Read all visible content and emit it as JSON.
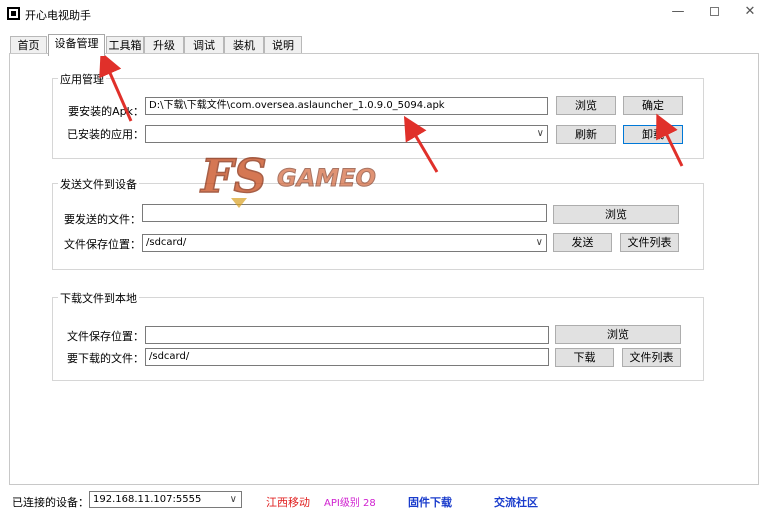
{
  "window": {
    "title": "开心电视助手",
    "minimize_label": "—",
    "close_label": "✕"
  },
  "tabs": [
    {
      "label": "首页"
    },
    {
      "label": "设备管理"
    },
    {
      "label": "工具箱"
    },
    {
      "label": "升级"
    },
    {
      "label": "调试"
    },
    {
      "label": "装机"
    },
    {
      "label": "说明"
    }
  ],
  "app_manage": {
    "title": "应用管理",
    "apk_label": "要安装的Apk：",
    "apk_value": "D:\\下载\\下载文件\\com.oversea.aslauncher_1.0.9.0_5094.apk",
    "browse_label": "浏览",
    "confirm_label": "确定",
    "installed_label": "已安装的应用：",
    "installed_value": "",
    "refresh_label": "刷新",
    "uninstall_label": "卸载"
  },
  "send_file": {
    "title": "发送文件到设备",
    "file_label": "要发送的文件：",
    "file_value": "",
    "browse_label": "浏览",
    "save_label": "文件保存位置：",
    "save_value": "/sdcard/",
    "send_label": "发送",
    "filelist_label": "文件列表"
  },
  "download_file": {
    "title": "下载文件到本地",
    "save_label": "文件保存位置：",
    "save_value": "",
    "browse_label": "浏览",
    "file_label": "要下载的文件：",
    "file_value": "/sdcard/",
    "download_label": "下载",
    "filelist_label": "文件列表"
  },
  "status": {
    "connected_label": "已连接的设备：",
    "device_value": "192.168.11.107:5555",
    "carrier": "江西移动",
    "api_level": "API级别 28",
    "firmware_link": "固件下载",
    "community_link": "交流社区"
  },
  "watermark": {
    "text": "GAMEO",
    "letters": "FS"
  },
  "colors": {
    "arrow": "#e0302a",
    "carrier": "#e02020",
    "api": "#d020d0",
    "link": "#1a3ccc",
    "focus": "#0078d7"
  }
}
